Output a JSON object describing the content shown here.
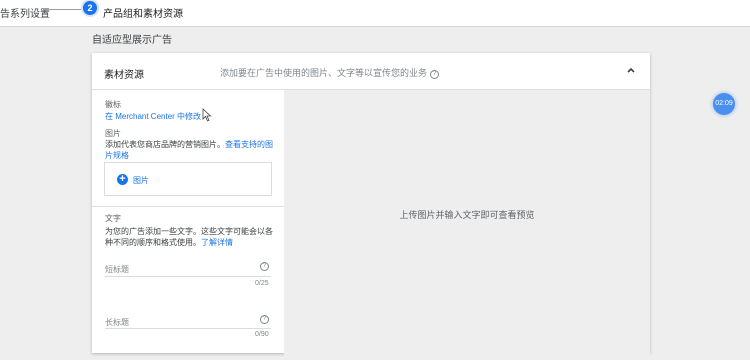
{
  "stepper": {
    "step1_label": "告系列设置",
    "step2_number": "2",
    "step2_label": "产品组和素材资源"
  },
  "section_title": "自适应型展示广告",
  "card": {
    "title": "素材资源",
    "description": "添加要在广告中使用的图片、文字等以宣传您的业务",
    "help_glyph": "?",
    "collapse_icon": "chevron-up-icon"
  },
  "logo": {
    "label": "徽标",
    "link": "在 Merchant Center 中修改"
  },
  "images": {
    "label": "图片",
    "desc": "添加代表您商店品牌的营销图片。",
    "desc_link": "查看支持的图片规格",
    "button_plus": "+",
    "button_label": "图片"
  },
  "text": {
    "label": "文字",
    "desc": "为您的广告添加一些文字。这些文字可能会以各种不同的顺序和格式使用。",
    "desc_link": "了解详情"
  },
  "fields": [
    {
      "label": "短标题",
      "counter": "0/25",
      "help": "?"
    },
    {
      "label": "长标题",
      "counter": "0/90",
      "help": "?"
    }
  ],
  "preview": {
    "text": "上传图片并输入文字即可查看预览"
  },
  "timer": "02:09"
}
